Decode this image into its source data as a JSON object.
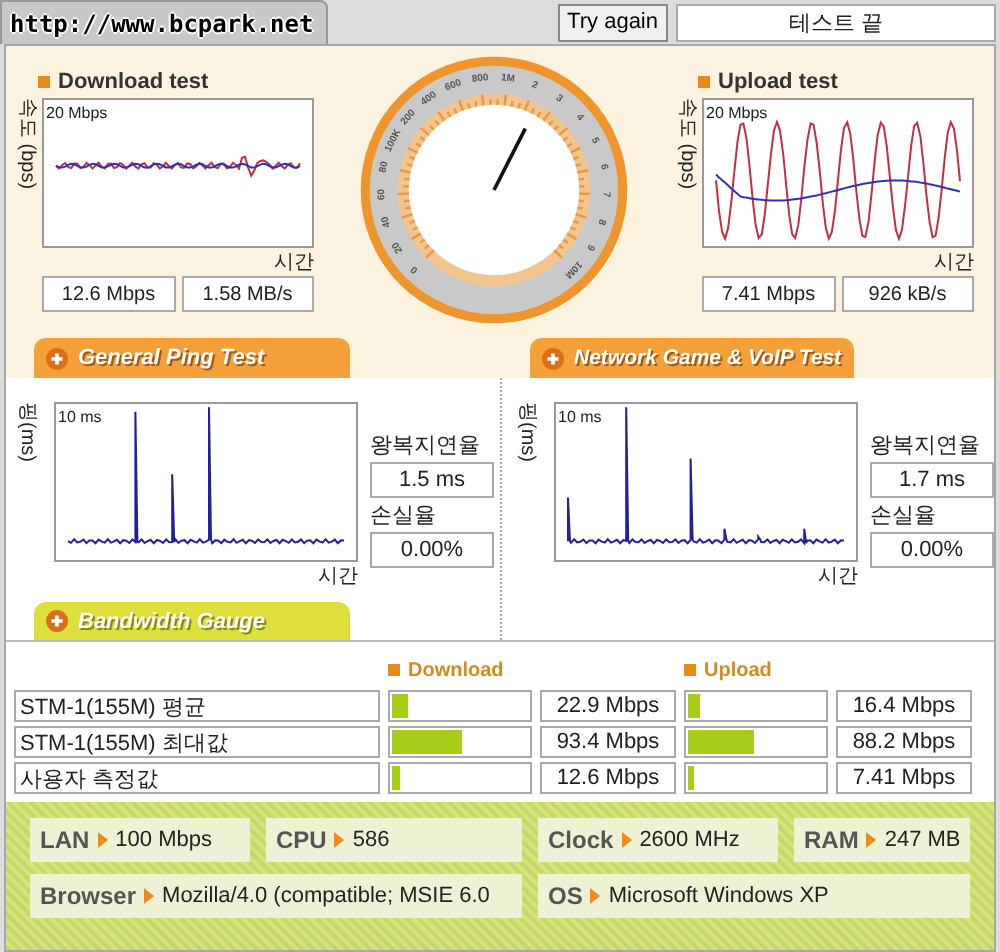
{
  "header": {
    "url": "http://www.bcpark.net",
    "retry_button": "Try again",
    "status": "테스트 끝"
  },
  "speed_tests": [
    {
      "title": "Download test",
      "y_label": "속도 (bps)",
      "top_label": "20 Mbps",
      "x_label": "시간",
      "readings": [
        "12.6 Mbps",
        "1.58 MB/s"
      ]
    },
    {
      "title": "Upload test",
      "y_label": "속도 (bps)",
      "top_label": "20 Mbps",
      "x_label": "시간",
      "readings": [
        "7.41 Mbps",
        "926 kB/s"
      ]
    }
  ],
  "gauge": {
    "labels": [
      "0",
      "20",
      "40",
      "60",
      "80",
      "100K",
      "200",
      "400",
      "600",
      "800",
      "1M",
      "2",
      "3",
      "4",
      "5",
      "6",
      "7",
      "8",
      "9",
      "10M"
    ]
  },
  "section_tabs": [
    "General Ping Test",
    "Network Game & VoIP Test"
  ],
  "ping_tests": [
    {
      "y_label": "핑(ms)",
      "top_label": "10 ms",
      "x_label": "시간",
      "rtt_label": "왕복지연율",
      "rtt": "1.5 ms",
      "loss_label": "손실율",
      "loss": "0.00%"
    },
    {
      "y_label": "핑(ms)",
      "top_label": "10 ms",
      "x_label": "시간",
      "rtt_label": "왕복지연율",
      "rtt": "1.7 ms",
      "loss_label": "손실율",
      "loss": "0.00%"
    }
  ],
  "bandwidth": {
    "tab": "Bandwidth Gauge",
    "columns": [
      "Download",
      "Upload"
    ],
    "rows": [
      {
        "label": "STM-1(155M) 평균",
        "download": {
          "level": 0.12,
          "reading": "22.9 Mbps"
        },
        "upload": {
          "level": 0.09,
          "reading": "16.4 Mbps"
        }
      },
      {
        "label": "STM-1(155M) 최대값",
        "download": {
          "level": 0.5,
          "reading": "93.4 Mbps"
        },
        "upload": {
          "level": 0.47,
          "reading": "88.2 Mbps"
        }
      },
      {
        "label": "사용자 측정값",
        "download": {
          "level": 0.05,
          "reading": "12.6 Mbps"
        },
        "upload": {
          "level": 0.04,
          "reading": "7.41 Mbps"
        }
      }
    ]
  },
  "system_info": [
    {
      "label": "LAN",
      "value": "100 Mbps"
    },
    {
      "label": "CPU",
      "value": "586"
    },
    {
      "label": "Clock",
      "value": "2600 MHz"
    },
    {
      "label": "RAM",
      "value": "247 MB"
    },
    {
      "label": "Browser",
      "value": "Mozilla/4.0 (compatible; MSIE 6.0"
    },
    {
      "label": "OS",
      "value": "Microsoft Windows XP"
    }
  ]
}
